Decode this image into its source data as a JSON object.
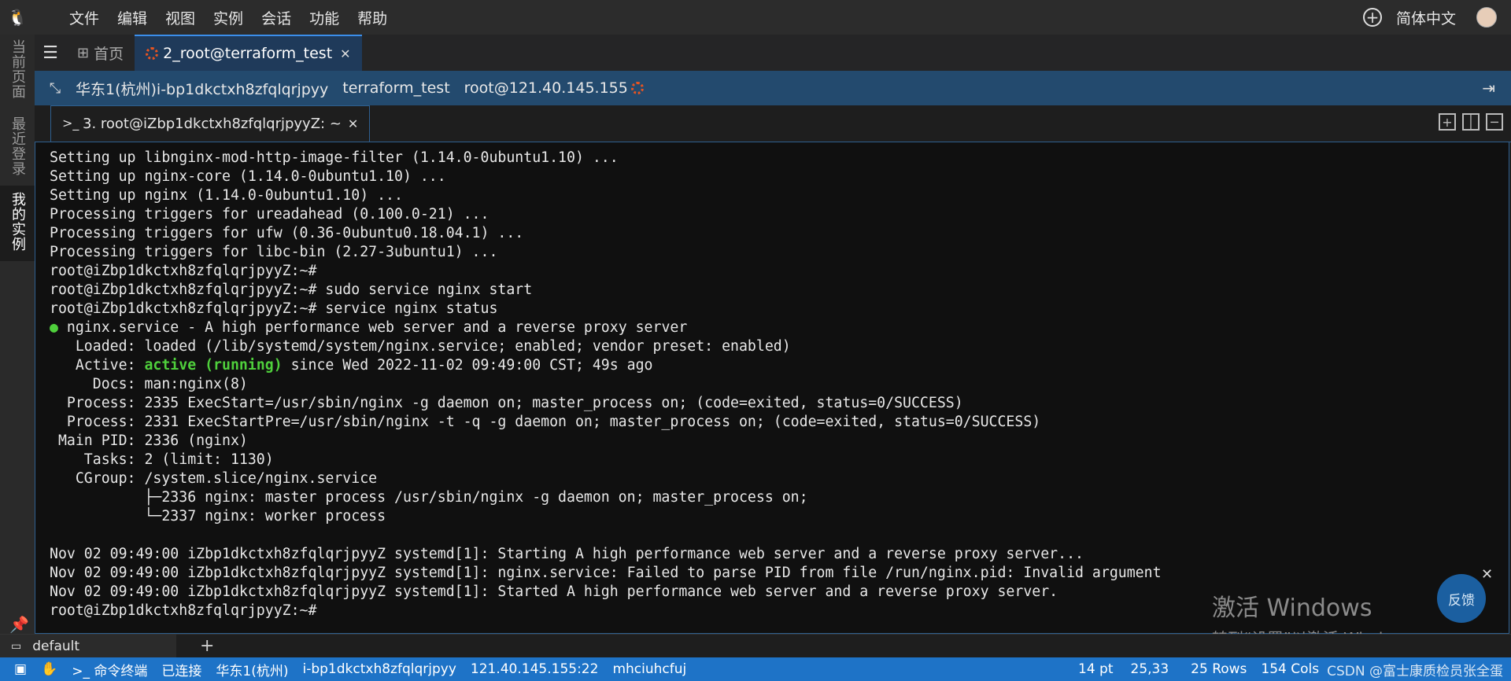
{
  "menubar": {
    "logo_icon": "penguin-icon",
    "items": [
      "文件",
      "编辑",
      "视图",
      "实例",
      "会话",
      "功能",
      "帮助"
    ],
    "language": "简体中文"
  },
  "activity_bar": {
    "tabs": [
      {
        "label": "当前页面"
      },
      {
        "label": "最近登录"
      },
      {
        "label": "我的实例"
      }
    ]
  },
  "tabs": [
    {
      "label": "首页"
    },
    {
      "label": "2_root@terraform_test"
    }
  ],
  "info": {
    "instance": "华东1(杭州)i-bp1dkctxh8zfqlqrjpyy",
    "name": "terraform_test",
    "user_host": "root@121.40.145.155"
  },
  "terminal_tab": {
    "label": "3. root@iZbp1dkctxh8zfqlqrjpyyZ: ~"
  },
  "terminal": {
    "lines": [
      "Setting up libnginx-mod-http-image-filter (1.14.0-0ubuntu1.10) ...",
      "Setting up nginx-core (1.14.0-0ubuntu1.10) ...",
      "Setting up nginx (1.14.0-0ubuntu1.10) ...",
      "Processing triggers for ureadahead (0.100.0-21) ...",
      "Processing triggers for ufw (0.36-0ubuntu0.18.04.1) ...",
      "Processing triggers for libc-bin (2.27-3ubuntu1) ...",
      "root@iZbp1dkctxh8zfqlqrjpyyZ:~#",
      "root@iZbp1dkctxh8zfqlqrjpyyZ:~# sudo service nginx start",
      "root@iZbp1dkctxh8zfqlqrjpyyZ:~# service nginx status",
      "",
      "   Loaded: loaded (/lib/systemd/system/nginx.service; enabled; vendor preset: enabled)",
      "",
      "     Docs: man:nginx(8)",
      "  Process: 2335 ExecStart=/usr/sbin/nginx -g daemon on; master_process on; (code=exited, status=0/SUCCESS)",
      "  Process: 2331 ExecStartPre=/usr/sbin/nginx -t -q -g daemon on; master_process on; (code=exited, status=0/SUCCESS)",
      " Main PID: 2336 (nginx)",
      "    Tasks: 2 (limit: 1130)",
      "   CGroup: /system.slice/nginx.service",
      "           ├─2336 nginx: master process /usr/sbin/nginx -g daemon on; master_process on;",
      "           └─2337 nginx: worker process",
      "",
      "Nov 02 09:49:00 iZbp1dkctxh8zfqlqrjpyyZ systemd[1]: Starting A high performance web server and a reverse proxy server...",
      "Nov 02 09:49:00 iZbp1dkctxh8zfqlqrjpyyZ systemd[1]: nginx.service: Failed to parse PID from file /run/nginx.pid: Invalid argument",
      "Nov 02 09:49:00 iZbp1dkctxh8zfqlqrjpyyZ systemd[1]: Started A high performance web server and a reverse proxy server.",
      "root@iZbp1dkctxh8zfqlqrjpyyZ:~#"
    ],
    "service_dot": "●",
    "service_line": " nginx.service - A high performance web server and a reverse proxy server",
    "active_prefix": "   Active: ",
    "active_state": "active (running)",
    "active_suffix": " since Wed 2022-11-02 09:49:00 CST; 49s ago",
    "accent_color": "#4fd03c"
  },
  "watermark": {
    "line1": "激活 Windows",
    "line2": "转到“设置”以激活 Windows。"
  },
  "feedback": {
    "label": "反馈"
  },
  "session": {
    "name": "default"
  },
  "statusbar": {
    "items": [
      "命令终端",
      "已连接",
      "华东1(杭州)",
      "i-bp1dkctxh8zfqlqrjpyy",
      "121.40.145.155:22",
      "mhciuhcfuj"
    ],
    "font_size": "14 pt",
    "cursor": "25,33",
    "rows": "25 Rows",
    "cols": "154 Cols",
    "csdn": "CSDN @富士康质检员张全蛋"
  }
}
